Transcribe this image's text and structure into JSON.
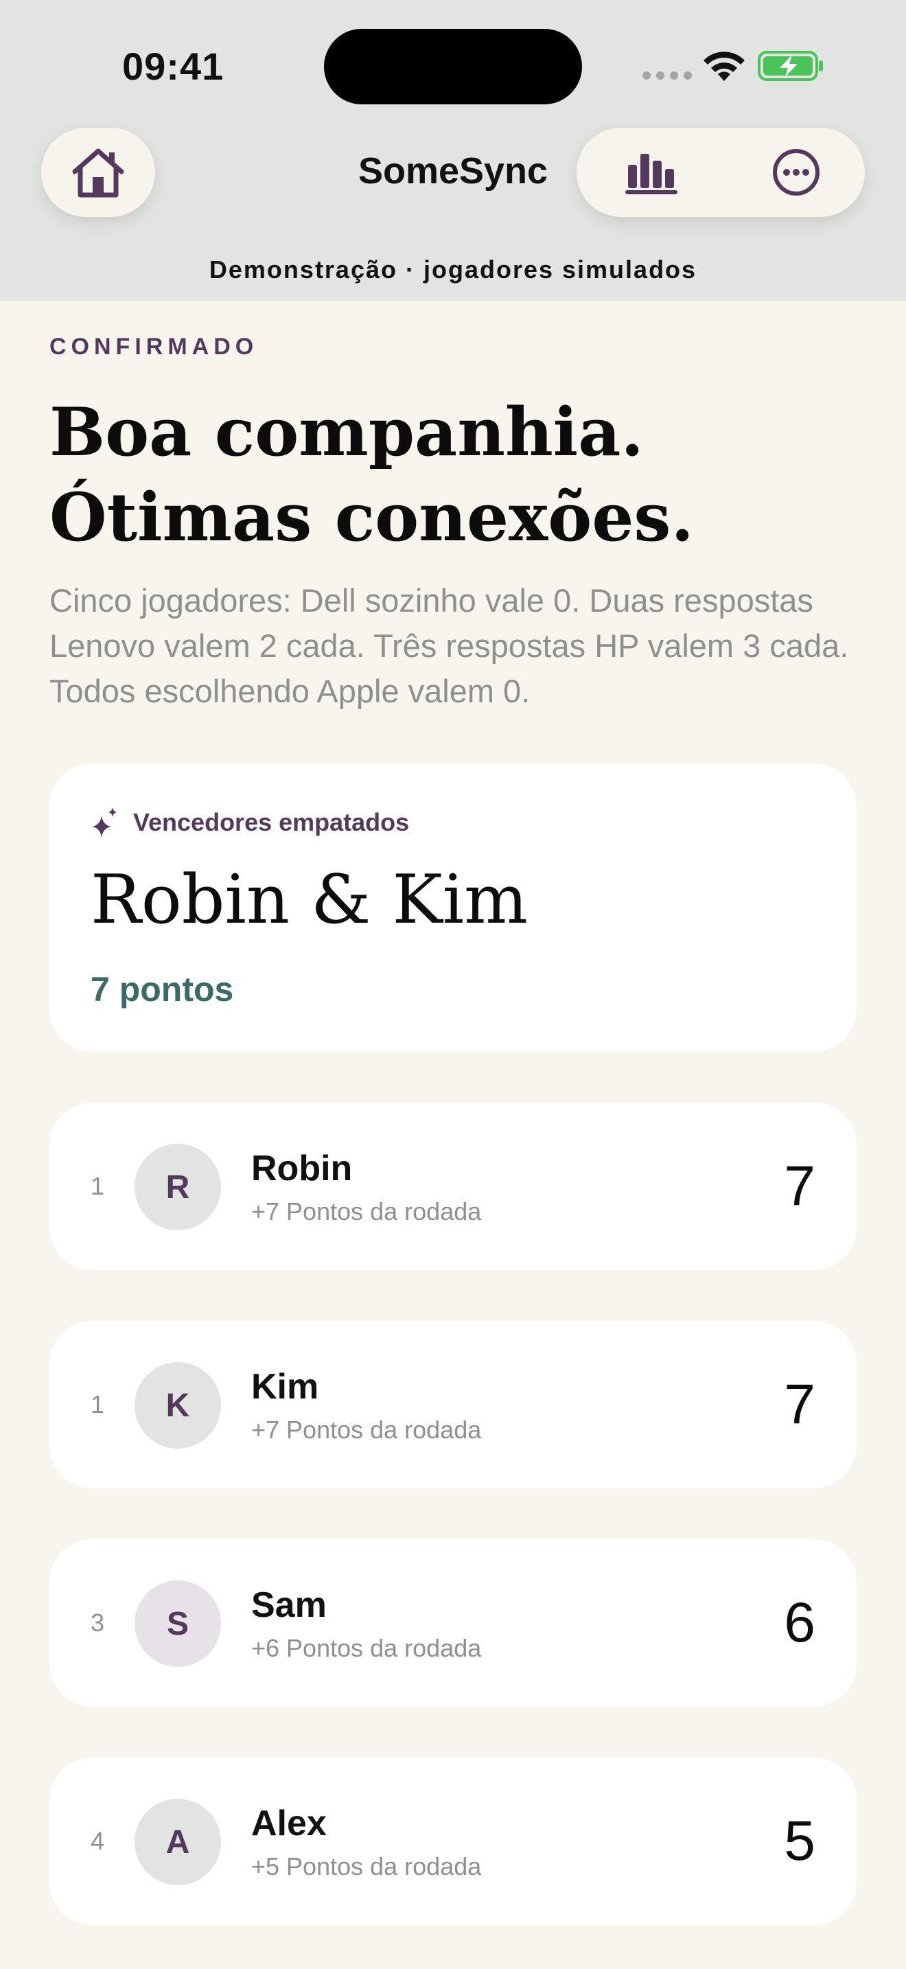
{
  "status_bar": {
    "time": "09:41"
  },
  "header": {
    "title": "SomeSync",
    "home_icon": "house-icon",
    "chart_icon": "bar-chart-icon",
    "more_icon": "ellipsis-circle-icon",
    "banner": "Demonstração · jogadores simulados"
  },
  "hero": {
    "eyebrow": "CONFIRMADO",
    "headline_line1": "Boa companhia.",
    "headline_line2": "Ótimas conexões.",
    "description": "Cinco jogadores: Dell sozinho vale 0. Duas respostas Lenovo valem 2 cada. Três respostas HP valem 3 cada. Todos escolhendo Apple valem 0."
  },
  "winner": {
    "label": "Vencedores empatados",
    "icon": "sparkles-icon",
    "names": "Robin & Kim",
    "points": "7 pontos"
  },
  "players": [
    {
      "rank": "1",
      "initial": "R",
      "name": "Robin",
      "sub": "+7 Pontos da rodada",
      "score": "7",
      "avatar_color": "#e1e4e0"
    },
    {
      "rank": "1",
      "initial": "K",
      "name": "Kim",
      "sub": "+7 Pontos da rodada",
      "score": "7",
      "avatar_color": "#e1e4e0"
    },
    {
      "rank": "3",
      "initial": "S",
      "name": "Sam",
      "sub": "+6 Pontos da rodada",
      "score": "6",
      "avatar_color": "#e6e2e8"
    },
    {
      "rank": "4",
      "initial": "A",
      "name": "Alex",
      "sub": "+5 Pontos da rodada",
      "score": "5",
      "avatar_color": "#e1e4e0"
    }
  ],
  "colors": {
    "accent": "#55395c",
    "points_green": "#3c6b67",
    "header_bg": "#e1e4e0",
    "page_bg": "#f8f5ef",
    "battery_green": "#4cc25a"
  }
}
